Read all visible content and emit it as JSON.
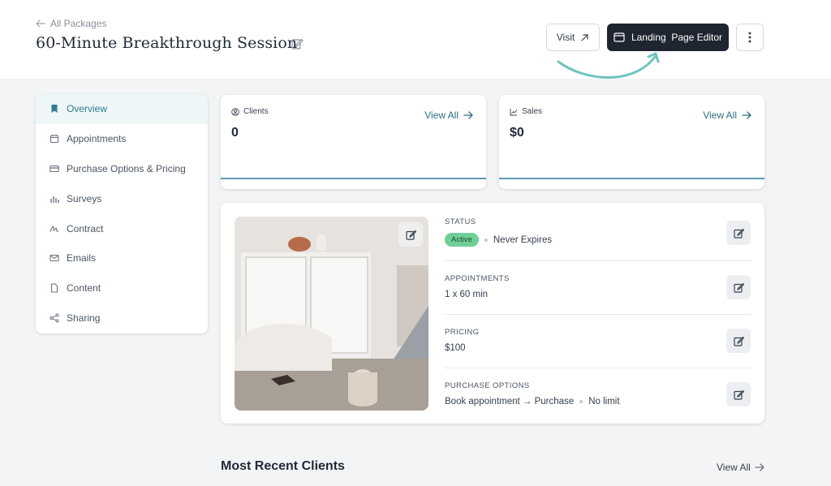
{
  "header": {
    "back_label": "All Packages",
    "title": "60-Minute Breakthrough Session",
    "visit_label": "Visit",
    "landing_editor_label": "Landing  Page Editor"
  },
  "sidebar": {
    "items": [
      {
        "label": "Overview",
        "icon": "bookmark-icon",
        "active": true
      },
      {
        "label": "Appointments",
        "icon": "calendar-icon"
      },
      {
        "label": "Purchase Options & Pricing",
        "icon": "credit-card-icon"
      },
      {
        "label": "Surveys",
        "icon": "bar-chart-icon"
      },
      {
        "label": "Contract",
        "icon": "signature-icon"
      },
      {
        "label": "Emails",
        "icon": "mail-icon"
      },
      {
        "label": "Content",
        "icon": "file-icon"
      },
      {
        "label": "Sharing",
        "icon": "share-icon"
      }
    ]
  },
  "stats": {
    "clients": {
      "label": "Clients",
      "value": "0",
      "view_all": "View All"
    },
    "sales": {
      "label": "Sales",
      "value": "$0",
      "view_all": "View All"
    }
  },
  "details": {
    "status": {
      "label": "STATUS",
      "badge": "Active",
      "expiry": "Never Expires"
    },
    "appointments": {
      "label": "APPOINTMENTS",
      "value": "1 x 60 min"
    },
    "pricing": {
      "label": "PRICING",
      "value": "$100"
    },
    "purchase_options": {
      "label": "PURCHASE OPTIONS",
      "flow": "Book appointment → Purchase",
      "limit": "No limit"
    }
  },
  "recent_clients": {
    "title": "Most Recent Clients",
    "view_all": "View All"
  },
  "colors": {
    "accent": "#2d7d8f",
    "dark_button": "#1e2530",
    "active_badge": "#6fcf97",
    "annotation_arrow": "#6cc5bd"
  }
}
